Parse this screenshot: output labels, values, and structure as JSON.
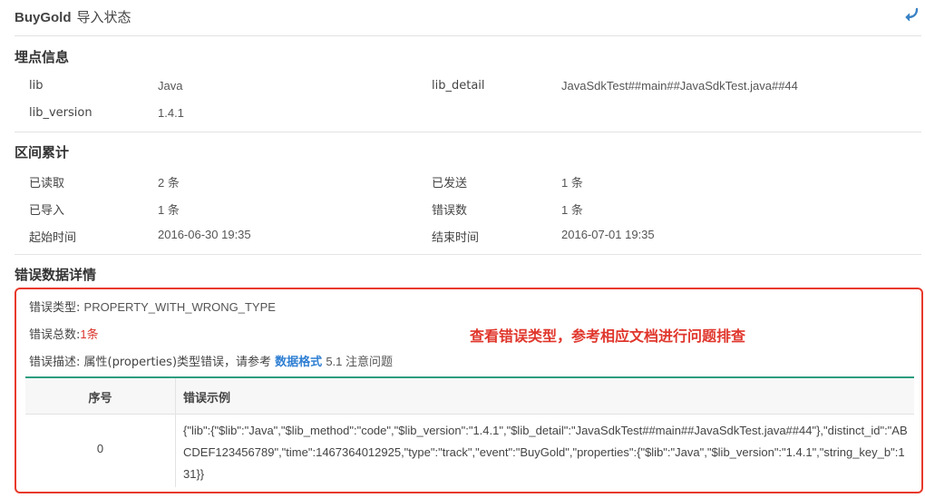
{
  "header": {
    "title_brand": "BuyGold",
    "title_text": "导入状态"
  },
  "lib_info": {
    "title": "埋点信息",
    "lib_label": "lib",
    "lib_value": "Java",
    "lib_detail_label": "lib_detail",
    "lib_detail_value": "JavaSdkTest##main##JavaSdkTest.java##44",
    "lib_version_label": "lib_version",
    "lib_version_value": "1.4.1"
  },
  "range_stats": {
    "title": "区间累计",
    "read_label": "已读取",
    "read_value": "2 条",
    "sent_label": "已发送",
    "sent_value": "1 条",
    "imported_label": "已导入",
    "imported_value": "1 条",
    "errors_label": "错误数",
    "errors_value": "1 条",
    "start_label": "起始时间",
    "start_value": "2016-06-30 19:35",
    "end_label": "结束时间",
    "end_value": "2016-07-01 19:35"
  },
  "error_details": {
    "title": "错误数据详情",
    "type_label": "错误类型:",
    "type_value": "PROPERTY_WITH_WRONG_TYPE",
    "count_label": "错误总数:",
    "count_value": "1",
    "count_unit": "条",
    "desc_label": "错误描述:",
    "desc_prefix": "属性(properties)类型错误，请参考",
    "desc_link": "数据格式",
    "desc_suffix": "5.1 注意问题",
    "annotation": "查看错误类型，参考相应文档进行问题排查",
    "table": {
      "col_index": "序号",
      "col_example": "错误示例",
      "rows": [
        {
          "index": "0",
          "example": "{\"lib\":{\"$lib\":\"Java\",\"$lib_method\":\"code\",\"$lib_version\":\"1.4.1\",\"$lib_detail\":\"JavaSdkTest##main##JavaSdkTest.java##44\"},\"distinct_id\":\"ABCDEF123456789\",\"time\":1467364012925,\"type\":\"track\",\"event\":\"BuyGold\",\"properties\":{\"$lib\":\"Java\",\"$lib_version\":\"1.4.1\",\"string_key_b\":131}}"
        }
      ]
    }
  },
  "colors": {
    "accent_green": "#2e9e80",
    "alert_red": "#e8392b",
    "link_blue": "#2f7fd3",
    "back_icon_blue": "#3b82c4"
  },
  "icons": {
    "back": "back-arrow-icon"
  }
}
